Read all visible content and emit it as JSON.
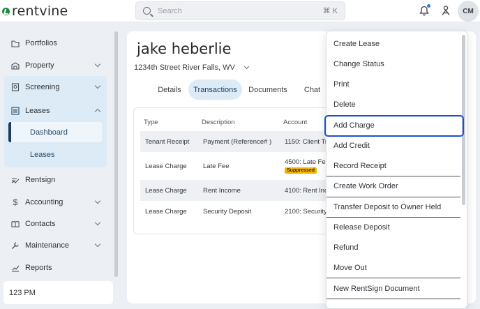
{
  "app": {
    "logo_text": "rentvine",
    "brand_color": "#1f8a3e"
  },
  "search": {
    "placeholder": "Search",
    "shortcut": "⌘ K"
  },
  "header": {
    "avatar_initials": "CM"
  },
  "sidebar": {
    "items": [
      {
        "label": "Portfolios",
        "icon": "folder-icon"
      },
      {
        "label": "Property",
        "icon": "building-icon"
      },
      {
        "label": "Screening",
        "icon": "screening-icon"
      },
      {
        "label": "Leases",
        "icon": "list-icon"
      },
      {
        "label": "Rentsign",
        "icon": "signature-icon"
      },
      {
        "label": "Accounting",
        "icon": "dollar-icon"
      },
      {
        "label": "Contacts",
        "icon": "book-icon"
      },
      {
        "label": "Maintenance",
        "icon": "wrench-icon"
      },
      {
        "label": "Reports",
        "icon": "chart-icon"
      }
    ],
    "lease_sub": {
      "dashboard": "Dashboard",
      "leases": "Leases"
    },
    "time_label": "123 PM"
  },
  "tenant": {
    "name": "jake heberlie",
    "address": "1234th Street River Falls, WV"
  },
  "tabs": [
    "Details",
    "Transactions",
    "Documents",
    "Chat"
  ],
  "table": {
    "headers": [
      "Type",
      "Description",
      "Account"
    ],
    "rows": [
      {
        "type": "Tenant Receipt",
        "description": "Payment (Reference# )",
        "account": "1150: Client Tru"
      },
      {
        "type": "Lease Charge",
        "description": "Late Fee",
        "account": "4500: Late Fee",
        "badge": "Suppressed"
      },
      {
        "type": "Lease Charge",
        "description": "Rent Income",
        "account": "4100: Rent Inco"
      },
      {
        "type": "Lease Charge",
        "description": "Security Deposit",
        "account": "2100: Security D"
      }
    ]
  },
  "menu": {
    "items": [
      "Create Lease",
      "Change Status",
      "Print",
      "Delete",
      "Add Charge",
      "Add Credit",
      "Record Receipt",
      "Create Work Order",
      "Transfer Deposit to Owner Held",
      "Release Deposit",
      "Refund",
      "Move Out",
      "New RentSign Document"
    ],
    "highlighted": "Add Charge",
    "highlight_color": "#1a4fd6"
  }
}
